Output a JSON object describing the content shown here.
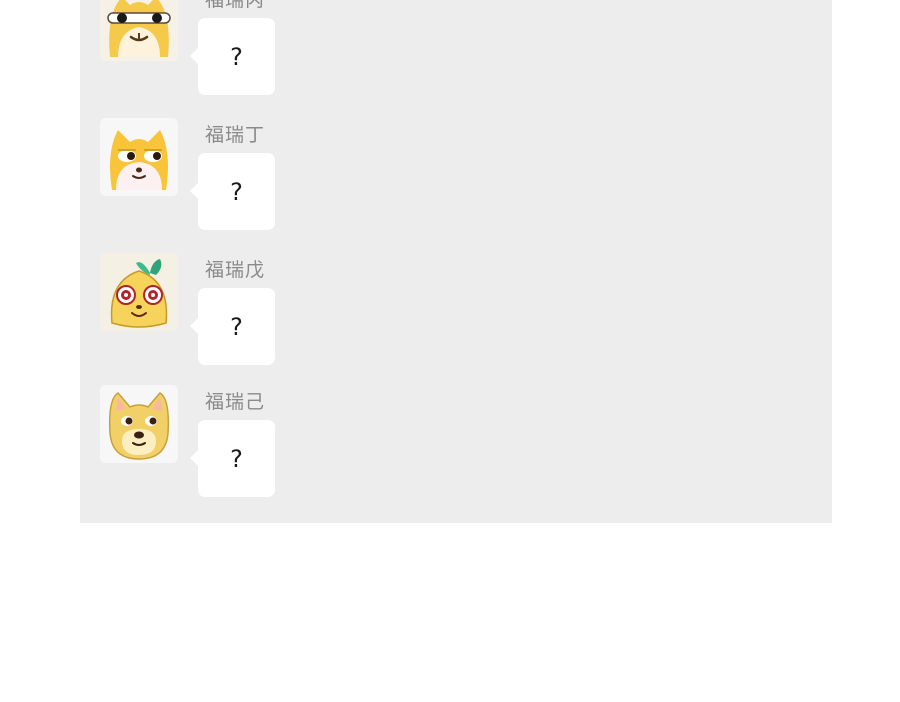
{
  "messages": [
    {
      "sender": "福瑞丙",
      "text": "?",
      "avatar": "sunglasses-dog-icon"
    },
    {
      "sender": "福瑞丁",
      "text": "?",
      "avatar": "side-eye-shiba-icon"
    },
    {
      "sender": "福瑞戊",
      "text": "?",
      "avatar": "sprout-dog-icon"
    },
    {
      "sender": "福瑞己",
      "text": "?",
      "avatar": "doge-icon"
    }
  ],
  "colors": {
    "chat_background": "#ededed",
    "bubble": "#ffffff",
    "sender_name": "#8a8a8a"
  }
}
